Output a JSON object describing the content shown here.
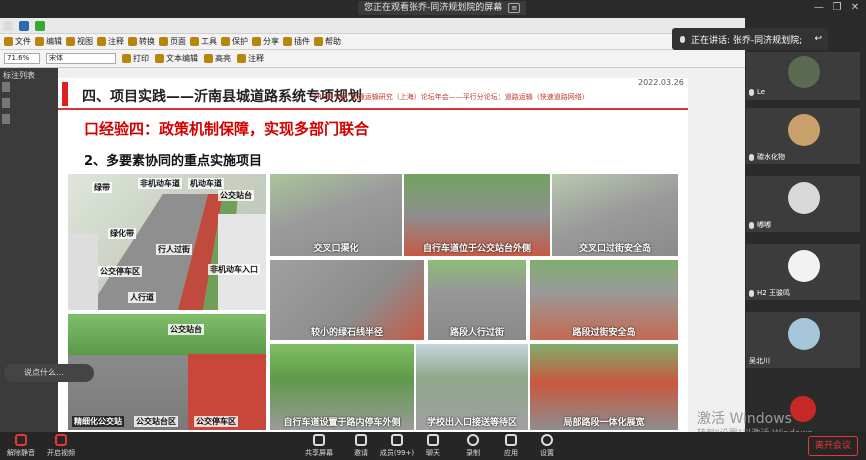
{
  "share_banner": {
    "text": "您正在观看张乔-同济规划院的屏幕"
  },
  "toolbar": {
    "row2_items": [
      "文件",
      "编辑",
      "视图",
      "注释",
      "转换",
      "页面",
      "工具",
      "保护",
      "分享",
      "插件",
      "帮助"
    ],
    "zoom": "71.6%",
    "font": "宋体",
    "row3_items": [
      "打印",
      "文本编辑",
      "高亮",
      "注释"
    ]
  },
  "left_pane": {
    "title": "标注列表"
  },
  "slide": {
    "date": "2022.03.26",
    "title": "四、项目实践——沂南县城道路系统专项规划",
    "subtitle": "TRF第十届“交通运输研究（上海）论坛年会——平行分论坛：道路运输（快速道路网络）",
    "experience": "口经验四：政策机制保障，实现多部门联合",
    "section": "2、多要素协同的重点实施项目",
    "diagram_labels": [
      "绿带",
      "非机动车道",
      "机动车道",
      "公交站台",
      "绿化带",
      "行人过街",
      "公交停车区",
      "非机动车入口",
      "人行道"
    ],
    "photos": [
      {
        "caption": "交叉口渠化"
      },
      {
        "caption": "自行车道位于公交站台外侧"
      },
      {
        "caption": "交叉口过街安全岛"
      },
      {
        "caption": "较小的绿石线半径"
      },
      {
        "caption": "路段人行过街"
      },
      {
        "caption": "路段过街安全岛"
      },
      {
        "caption": "自行车道设置于路内停车外侧"
      },
      {
        "caption": "学校出入口接送等待区"
      },
      {
        "caption": "局部路段一体化展宽"
      }
    ],
    "bus_photo": {
      "label_station": "公交站台",
      "label_left": "精细化公交站",
      "label_mid": "公交站台区",
      "label_right": "公交停车区"
    }
  },
  "right_panel": {
    "speaking": "正在讲话: 张乔-同济规划院;",
    "participants": [
      {
        "name": "Le"
      },
      {
        "name": "碳水化物"
      },
      {
        "name": "嘟嘟"
      },
      {
        "name": "H2 王骏鸣"
      },
      {
        "name": "吴北川"
      },
      {
        "name": ""
      }
    ]
  },
  "chat": {
    "placeholder": "说点什么..."
  },
  "watermark": {
    "line1": "激活 Windows",
    "line2": "转到“设置”以激活 Windows。"
  },
  "bottom": {
    "buttons": [
      "解除静音",
      "开启视频",
      "共享屏幕",
      "邀请",
      "成员(99+)",
      "聊天",
      "录制",
      "应用",
      "设置"
    ],
    "leave": "离开会议"
  },
  "colors": {
    "accent_red": "#d40000",
    "leave": "#e53935"
  }
}
